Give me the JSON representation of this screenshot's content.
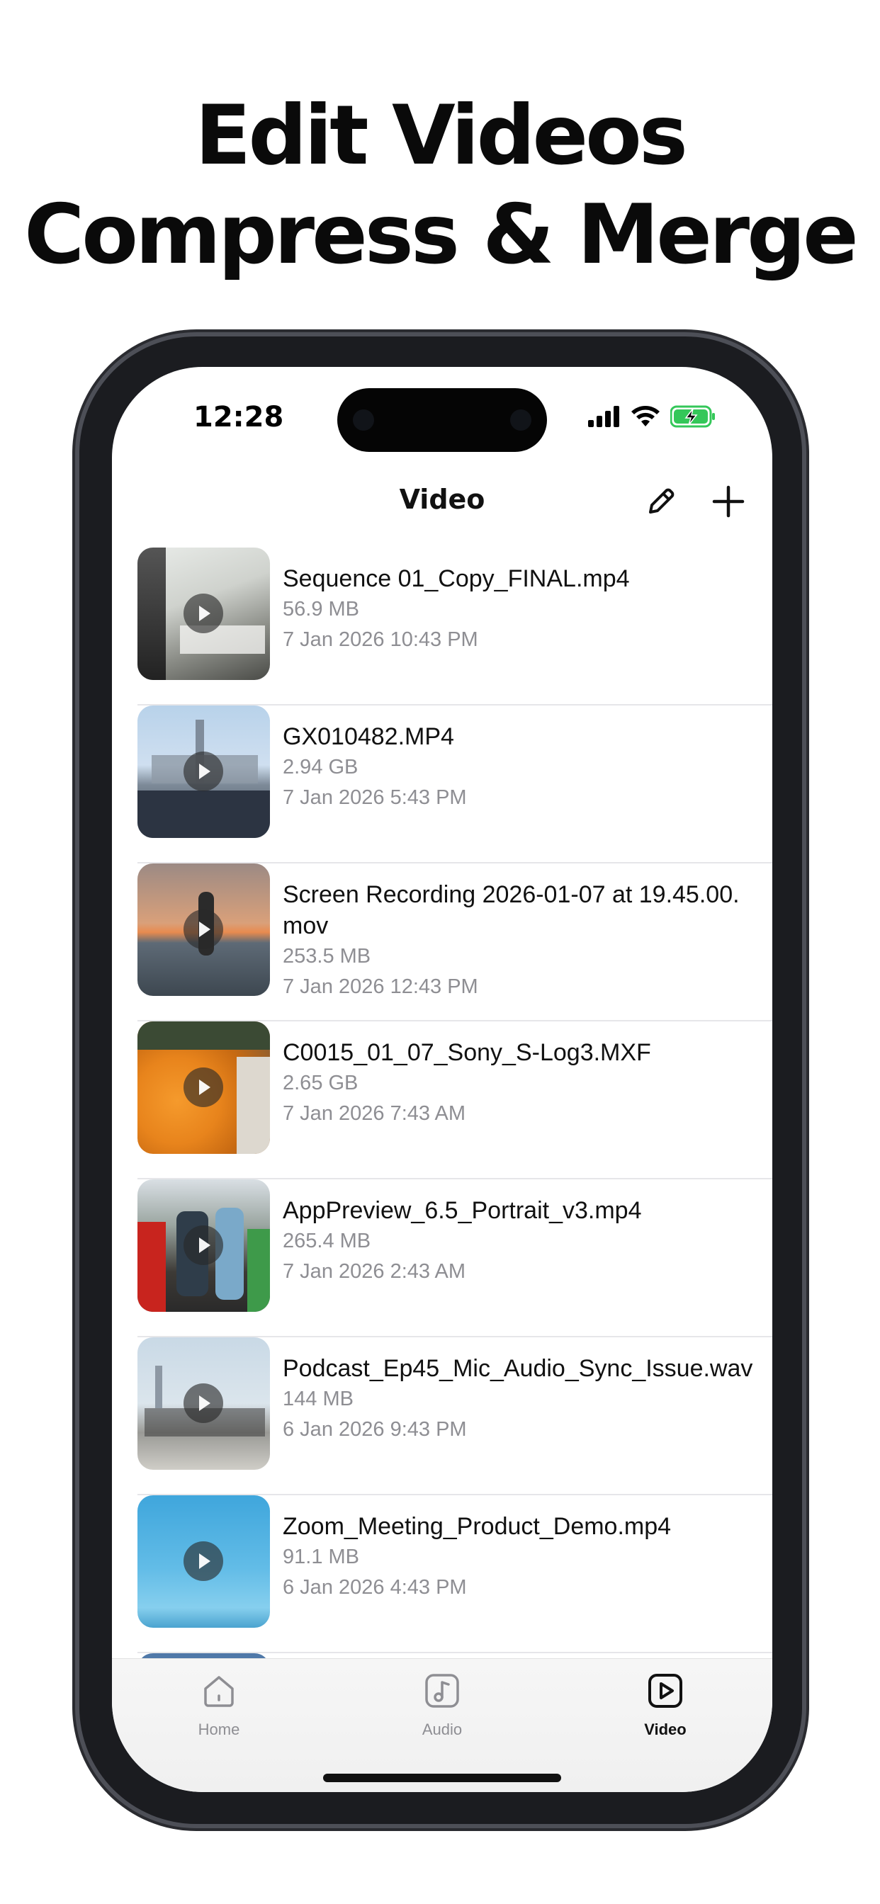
{
  "promo": {
    "line1": "Edit Videos",
    "line2": "Compress & Merge"
  },
  "status_bar": {
    "time": "12:28"
  },
  "nav": {
    "title": "Video",
    "edit_icon": "pencil-icon",
    "add_icon": "plus-icon"
  },
  "videos": [
    {
      "name": "Sequence 01_Copy_FINAL.mp4",
      "size": "56.9 MB",
      "date": "7 Jan 2026 10:43 PM"
    },
    {
      "name": "GX010482.MP4",
      "size": "2.94 GB",
      "date": "7 Jan 2026 5:43 PM"
    },
    {
      "name": "Screen Recording 2026-01-07 at 19.45.00.mov",
      "size": "253.5 MB",
      "date": "7 Jan 2026 12:43 PM"
    },
    {
      "name": "C0015_01_07_Sony_S-Log3.MXF",
      "size": "2.65 GB",
      "date": "7 Jan 2026 7:43 AM"
    },
    {
      "name": "AppPreview_6.5_Portrait_v3.mp4",
      "size": "265.4 MB",
      "date": "7 Jan 2026 2:43 AM"
    },
    {
      "name": "Podcast_Ep45_Mic_Audio_Sync_Issue.wav",
      "size": "144 MB",
      "date": "6 Jan 2026 9:43 PM"
    },
    {
      "name": "Zoom_Meeting_Product_Demo.mp4",
      "size": "91.1 MB",
      "date": "6 Jan 2026 4:43 PM"
    }
  ],
  "tabs": [
    {
      "label": "Home",
      "icon": "home-icon"
    },
    {
      "label": "Audio",
      "icon": "music-note-icon"
    },
    {
      "label": "Video",
      "icon": "play-square-icon",
      "active": true
    }
  ],
  "colors": {
    "accent": "#111111",
    "inactive": "#8e8e93",
    "battery": "#34c759"
  }
}
